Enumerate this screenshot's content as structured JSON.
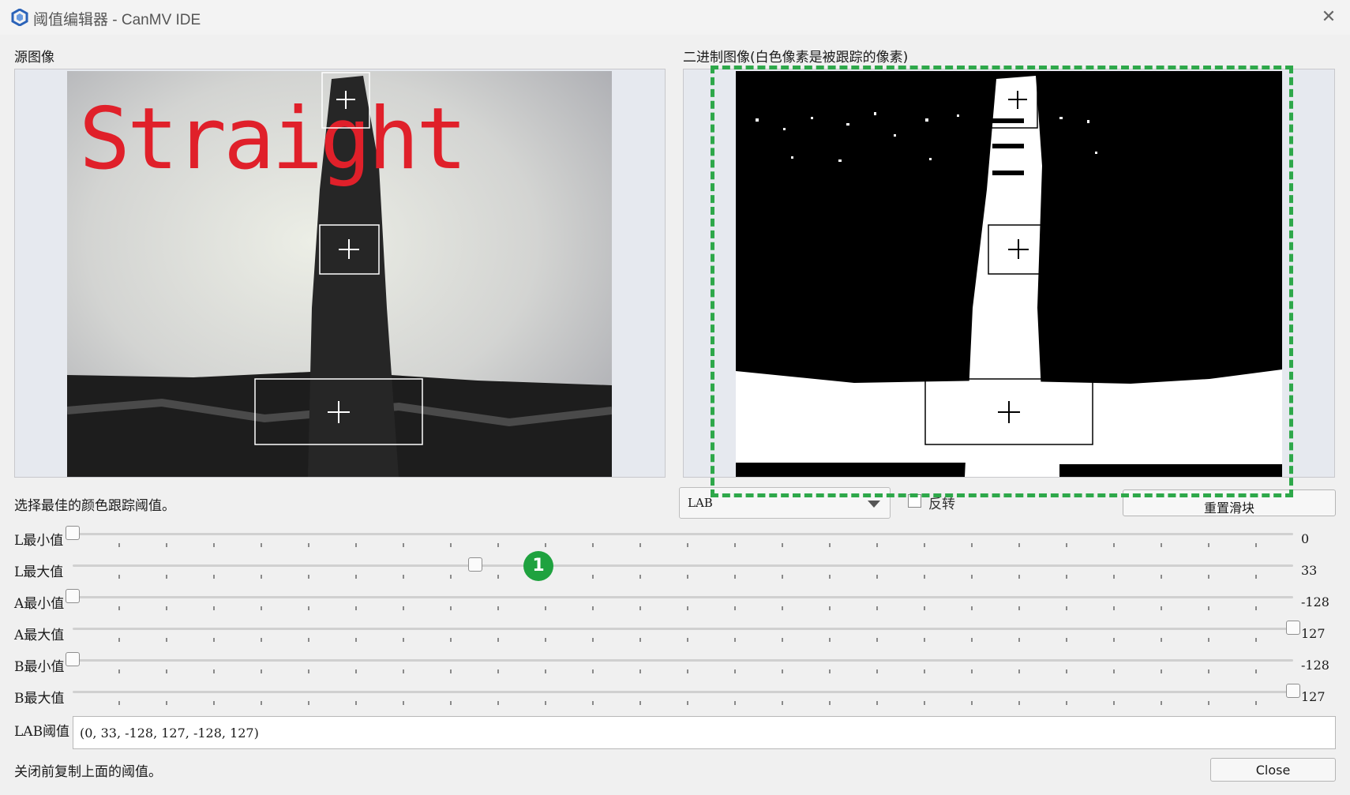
{
  "window": {
    "title": "阈值编辑器 - CanMV IDE",
    "close_glyph": "✕"
  },
  "source_panel": {
    "label": "源图像",
    "overlay_text": "Straight"
  },
  "binary_panel": {
    "label": "二进制图像(白色像素是被跟踪的像素)"
  },
  "hint": "选择最佳的颜色跟踪阈值。",
  "controls": {
    "color_space": "LAB",
    "invert_label": "反转",
    "invert_checked": false,
    "reset_label": "重置滑块"
  },
  "sliders": [
    {
      "label": "L最小值",
      "value": "0",
      "fraction": 0.0
    },
    {
      "label": "L最大值",
      "value": "33",
      "fraction": 0.33
    },
    {
      "label": "A最小值",
      "value": "-128",
      "fraction": 0.0
    },
    {
      "label": "A最大值",
      "value": "127",
      "fraction": 1.0
    },
    {
      "label": "B最小值",
      "value": "-128",
      "fraction": 0.0
    },
    {
      "label": "B最大值",
      "value": "127",
      "fraction": 1.0
    }
  ],
  "threshold": {
    "label": "LAB阈值",
    "value": "(0, 33, -128, 127, -128, 127)"
  },
  "footer": {
    "note": "关闭前复制上面的阈值。",
    "close_label": "Close"
  },
  "annotation": {
    "badge_number": "1",
    "accent_color": "#2ea84a"
  }
}
